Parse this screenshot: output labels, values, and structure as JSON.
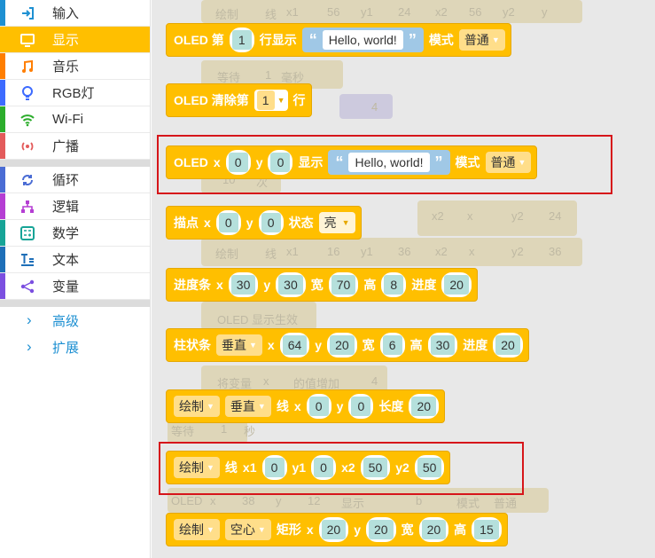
{
  "sidebar": {
    "categories": [
      {
        "label": "输入",
        "color": "#1e90d2",
        "icon": "input-icon"
      },
      {
        "label": "显示",
        "color": "#ffbf00",
        "icon": "monitor-icon",
        "selected": true
      },
      {
        "label": "音乐",
        "color": "#ff7e00",
        "icon": "music-note-icon"
      },
      {
        "label": "RGB灯",
        "color": "#3d6bff",
        "icon": "lightbulb-icon"
      },
      {
        "label": "Wi-Fi",
        "color": "#2cad2c",
        "icon": "wifi-icon"
      },
      {
        "label": "广播",
        "color": "#e35b5b",
        "icon": "broadcast-icon"
      },
      {
        "label": "循环",
        "color": "#4a6cd4",
        "icon": "loop-icon"
      },
      {
        "label": "逻辑",
        "color": "#b53ed3",
        "icon": "logic-tree-icon"
      },
      {
        "label": "数学",
        "color": "#17a497",
        "icon": "calculator-icon"
      },
      {
        "label": "文本",
        "color": "#1e6fb8",
        "icon": "text-icon"
      },
      {
        "label": "变量",
        "color": "#7b4fe0",
        "icon": "variable-icon"
      }
    ],
    "extras": [
      {
        "label": "高级"
      },
      {
        "label": "扩展"
      }
    ]
  },
  "ghost_texts": [
    "绘制",
    "线",
    "x1",
    "56",
    "y1",
    "24",
    "x2",
    "56",
    "y2",
    "y",
    "等待",
    "1",
    "毫秒",
    "4",
    "10",
    "次",
    "x2",
    "x",
    "y2",
    "24",
    "绘制",
    "线",
    "x1",
    "16",
    "y1",
    "36",
    "x2",
    "x",
    "y2",
    "36",
    "OLED 显示生效",
    "将变量",
    "x",
    "的值增加",
    "4",
    "等待",
    "1",
    "秒",
    "OLED",
    "x",
    "38",
    "y",
    "12",
    "显示",
    "b",
    "模式",
    "普通"
  ],
  "blocks": {
    "b1": {
      "t1": "OLED 第",
      "n1": "1",
      "t2": "行显示",
      "s": "Hello, world!",
      "t3": "模式",
      "mode": "普通"
    },
    "b2": {
      "t1": "OLED 清除第",
      "n1": "1",
      "t2": "行"
    },
    "b3": {
      "t1": "OLED",
      "tx": "x",
      "x": "0",
      "ty": "y",
      "y": "0",
      "t2": "显示",
      "s": "Hello, world!",
      "t3": "模式",
      "mode": "普通"
    },
    "b4": {
      "t1": "描点",
      "tx": "x",
      "x": "0",
      "ty": "y",
      "y": "0",
      "t2": "状态",
      "state": "亮"
    },
    "b5": {
      "t1": "进度条",
      "tx": "x",
      "x": "30",
      "ty": "y",
      "y": "30",
      "tw": "宽",
      "w": "70",
      "th": "高",
      "h": "8",
      "tp": "进度",
      "p": "20"
    },
    "b6": {
      "t1": "柱状条",
      "dir": "垂直",
      "tx": "x",
      "x": "64",
      "ty": "y",
      "y": "20",
      "tw": "宽",
      "w": "6",
      "th": "高",
      "h": "30",
      "tp": "进度",
      "p": "20"
    },
    "b7": {
      "d1": "绘制",
      "dir": "垂直",
      "t1": "线",
      "tx": "x",
      "x": "0",
      "ty": "y",
      "y": "0",
      "tl": "长度",
      "l": "20"
    },
    "b8": {
      "d1": "绘制",
      "t1": "线",
      "tx1": "x1",
      "x1": "0",
      "ty1": "y1",
      "y1": "0",
      "tx2": "x2",
      "x2": "50",
      "ty2": "y2",
      "y2": "50"
    },
    "b9": {
      "d1": "绘制",
      "fill": "空心",
      "t1": "矩形",
      "tx": "x",
      "x": "20",
      "ty": "y",
      "y": "20",
      "tw": "宽",
      "w": "20",
      "th": "高",
      "h": "15"
    }
  }
}
